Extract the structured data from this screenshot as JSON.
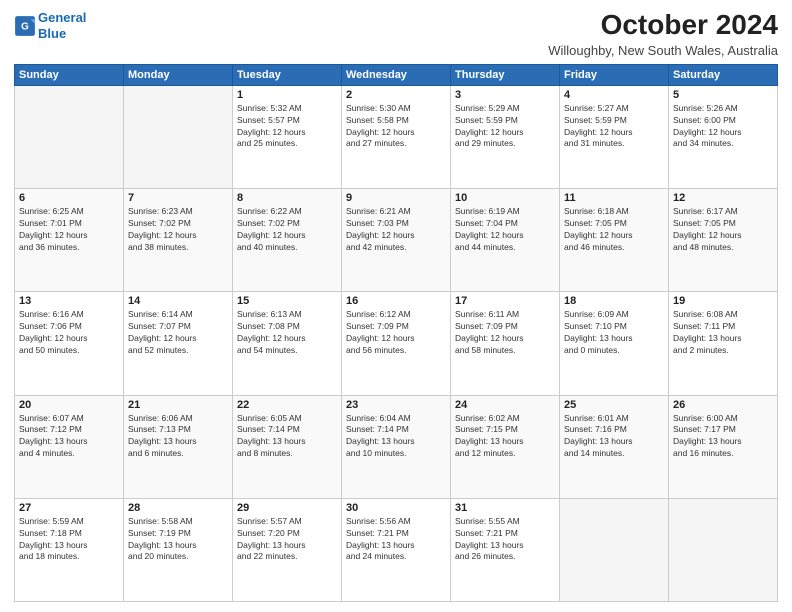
{
  "logo": {
    "line1": "General",
    "line2": "Blue"
  },
  "title": "October 2024",
  "subtitle": "Willoughby, New South Wales, Australia",
  "weekdays": [
    "Sunday",
    "Monday",
    "Tuesday",
    "Wednesday",
    "Thursday",
    "Friday",
    "Saturday"
  ],
  "weeks": [
    [
      {
        "day": "",
        "info": ""
      },
      {
        "day": "",
        "info": ""
      },
      {
        "day": "1",
        "info": "Sunrise: 5:32 AM\nSunset: 5:57 PM\nDaylight: 12 hours\nand 25 minutes."
      },
      {
        "day": "2",
        "info": "Sunrise: 5:30 AM\nSunset: 5:58 PM\nDaylight: 12 hours\nand 27 minutes."
      },
      {
        "day": "3",
        "info": "Sunrise: 5:29 AM\nSunset: 5:59 PM\nDaylight: 12 hours\nand 29 minutes."
      },
      {
        "day": "4",
        "info": "Sunrise: 5:27 AM\nSunset: 5:59 PM\nDaylight: 12 hours\nand 31 minutes."
      },
      {
        "day": "5",
        "info": "Sunrise: 5:26 AM\nSunset: 6:00 PM\nDaylight: 12 hours\nand 34 minutes."
      }
    ],
    [
      {
        "day": "6",
        "info": "Sunrise: 6:25 AM\nSunset: 7:01 PM\nDaylight: 12 hours\nand 36 minutes."
      },
      {
        "day": "7",
        "info": "Sunrise: 6:23 AM\nSunset: 7:02 PM\nDaylight: 12 hours\nand 38 minutes."
      },
      {
        "day": "8",
        "info": "Sunrise: 6:22 AM\nSunset: 7:02 PM\nDaylight: 12 hours\nand 40 minutes."
      },
      {
        "day": "9",
        "info": "Sunrise: 6:21 AM\nSunset: 7:03 PM\nDaylight: 12 hours\nand 42 minutes."
      },
      {
        "day": "10",
        "info": "Sunrise: 6:19 AM\nSunset: 7:04 PM\nDaylight: 12 hours\nand 44 minutes."
      },
      {
        "day": "11",
        "info": "Sunrise: 6:18 AM\nSunset: 7:05 PM\nDaylight: 12 hours\nand 46 minutes."
      },
      {
        "day": "12",
        "info": "Sunrise: 6:17 AM\nSunset: 7:05 PM\nDaylight: 12 hours\nand 48 minutes."
      }
    ],
    [
      {
        "day": "13",
        "info": "Sunrise: 6:16 AM\nSunset: 7:06 PM\nDaylight: 12 hours\nand 50 minutes."
      },
      {
        "day": "14",
        "info": "Sunrise: 6:14 AM\nSunset: 7:07 PM\nDaylight: 12 hours\nand 52 minutes."
      },
      {
        "day": "15",
        "info": "Sunrise: 6:13 AM\nSunset: 7:08 PM\nDaylight: 12 hours\nand 54 minutes."
      },
      {
        "day": "16",
        "info": "Sunrise: 6:12 AM\nSunset: 7:09 PM\nDaylight: 12 hours\nand 56 minutes."
      },
      {
        "day": "17",
        "info": "Sunrise: 6:11 AM\nSunset: 7:09 PM\nDaylight: 12 hours\nand 58 minutes."
      },
      {
        "day": "18",
        "info": "Sunrise: 6:09 AM\nSunset: 7:10 PM\nDaylight: 13 hours\nand 0 minutes."
      },
      {
        "day": "19",
        "info": "Sunrise: 6:08 AM\nSunset: 7:11 PM\nDaylight: 13 hours\nand 2 minutes."
      }
    ],
    [
      {
        "day": "20",
        "info": "Sunrise: 6:07 AM\nSunset: 7:12 PM\nDaylight: 13 hours\nand 4 minutes."
      },
      {
        "day": "21",
        "info": "Sunrise: 6:06 AM\nSunset: 7:13 PM\nDaylight: 13 hours\nand 6 minutes."
      },
      {
        "day": "22",
        "info": "Sunrise: 6:05 AM\nSunset: 7:14 PM\nDaylight: 13 hours\nand 8 minutes."
      },
      {
        "day": "23",
        "info": "Sunrise: 6:04 AM\nSunset: 7:14 PM\nDaylight: 13 hours\nand 10 minutes."
      },
      {
        "day": "24",
        "info": "Sunrise: 6:02 AM\nSunset: 7:15 PM\nDaylight: 13 hours\nand 12 minutes."
      },
      {
        "day": "25",
        "info": "Sunrise: 6:01 AM\nSunset: 7:16 PM\nDaylight: 13 hours\nand 14 minutes."
      },
      {
        "day": "26",
        "info": "Sunrise: 6:00 AM\nSunset: 7:17 PM\nDaylight: 13 hours\nand 16 minutes."
      }
    ],
    [
      {
        "day": "27",
        "info": "Sunrise: 5:59 AM\nSunset: 7:18 PM\nDaylight: 13 hours\nand 18 minutes."
      },
      {
        "day": "28",
        "info": "Sunrise: 5:58 AM\nSunset: 7:19 PM\nDaylight: 13 hours\nand 20 minutes."
      },
      {
        "day": "29",
        "info": "Sunrise: 5:57 AM\nSunset: 7:20 PM\nDaylight: 13 hours\nand 22 minutes."
      },
      {
        "day": "30",
        "info": "Sunrise: 5:56 AM\nSunset: 7:21 PM\nDaylight: 13 hours\nand 24 minutes."
      },
      {
        "day": "31",
        "info": "Sunrise: 5:55 AM\nSunset: 7:21 PM\nDaylight: 13 hours\nand 26 minutes."
      },
      {
        "day": "",
        "info": ""
      },
      {
        "day": "",
        "info": ""
      }
    ]
  ]
}
